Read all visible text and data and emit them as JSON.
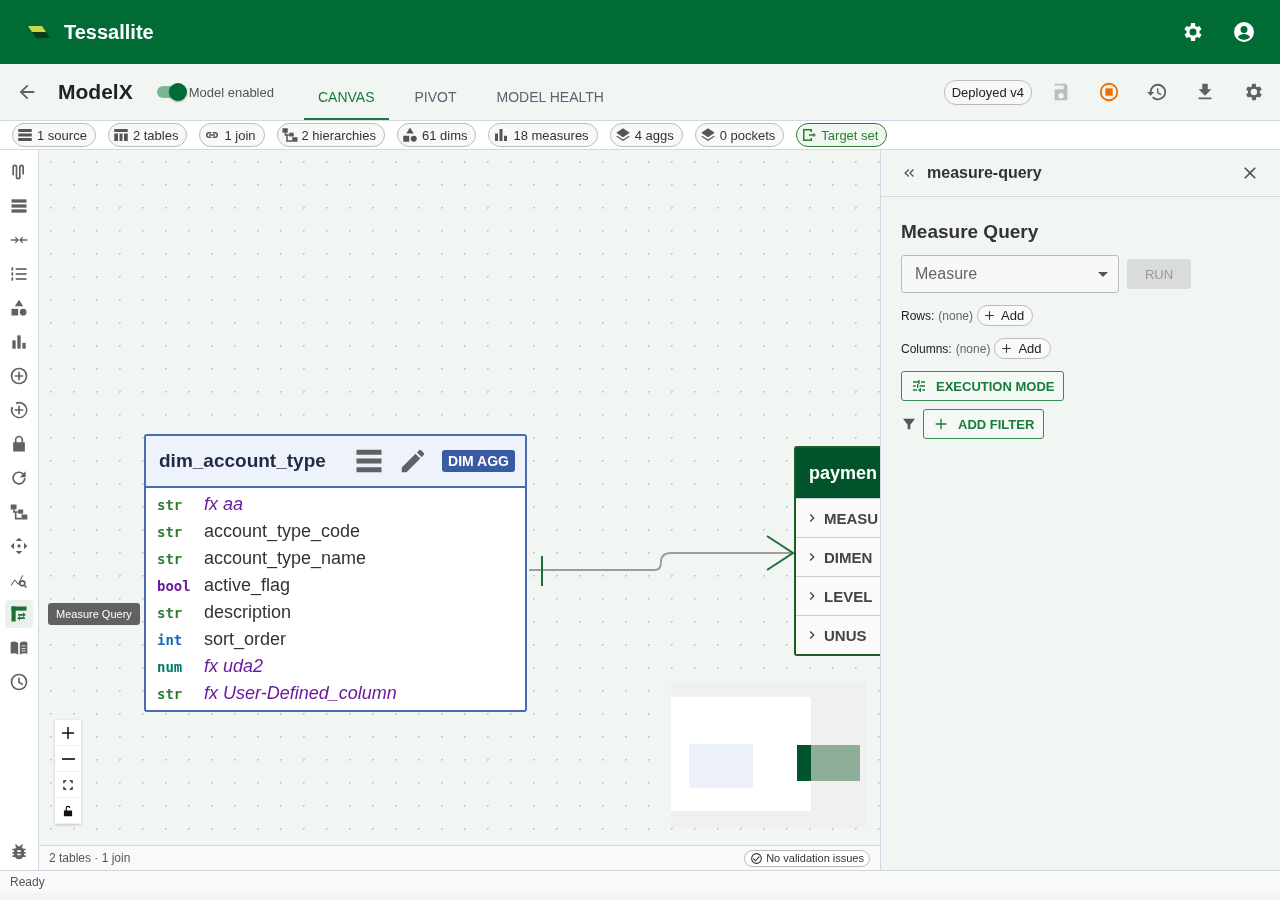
{
  "app": {
    "name": "Tessallite"
  },
  "toolbar": {
    "model_name": "ModelX",
    "toggle": {
      "label": "Model enabled",
      "on": true
    },
    "tabs": [
      {
        "label": "CANVAS",
        "selected": true
      },
      {
        "label": "PIVOT",
        "selected": false
      },
      {
        "label": "MODEL HEALTH",
        "selected": false
      }
    ],
    "version": "Deployed v4"
  },
  "chips": [
    {
      "kind": "source",
      "label": "1 source",
      "highlighted": false
    },
    {
      "kind": "tables",
      "label": "2 tables",
      "highlighted": false
    },
    {
      "kind": "join",
      "label": "1 join",
      "highlighted": false
    },
    {
      "kind": "hierarchy",
      "label": "2 hierarchies",
      "highlighted": false
    },
    {
      "kind": "dims",
      "label": "61 dims",
      "highlighted": false
    },
    {
      "kind": "measures",
      "label": "18 measures",
      "highlighted": false
    },
    {
      "kind": "layers",
      "label": "4 aggs",
      "highlighted": false
    },
    {
      "kind": "layers",
      "label": "0 pockets",
      "highlighted": false
    },
    {
      "kind": "target",
      "label": "Target set",
      "highlighted": true
    }
  ],
  "rail": {
    "items": [
      {
        "selected": false
      },
      {
        "selected": false
      },
      {
        "selected": false
      },
      {
        "selected": false
      },
      {
        "selected": false
      },
      {
        "selected": false
      },
      {
        "selected": false
      },
      {
        "selected": false
      },
      {
        "selected": false
      },
      {
        "selected": false
      },
      {
        "selected": false
      },
      {
        "selected": false
      },
      {
        "selected": false
      },
      {
        "selected": true
      },
      {
        "selected": false
      },
      {
        "selected": false
      }
    ],
    "tooltip": "Measure Query"
  },
  "canvas": {
    "tables": [
      {
        "name": "dim_account_type",
        "badge": "DIM AGG",
        "fields": [
          {
            "type": "str",
            "name": "fx aa",
            "computed": true
          },
          {
            "type": "str",
            "name": "account_type_code",
            "computed": false
          },
          {
            "type": "str",
            "name": "account_type_name",
            "computed": false
          },
          {
            "type": "bool",
            "name": "active_flag",
            "computed": false
          },
          {
            "type": "str",
            "name": "description",
            "computed": false
          },
          {
            "type": "int",
            "name": "sort_order",
            "computed": false
          },
          {
            "type": "num",
            "name": "fx uda2",
            "computed": true
          },
          {
            "type": "str",
            "name": "fx User-Defined_column",
            "computed": true
          }
        ]
      }
    ],
    "fact": {
      "name": "paymen",
      "sections": [
        "MEASU",
        "DIMEN",
        "LEVEL",
        "UNUS"
      ]
    },
    "footer": "2 tables · 1 join",
    "validation": "No validation issues"
  },
  "panel": {
    "id": "measure-query",
    "title": "Measure Query",
    "select_placeholder": "Measure",
    "run": "RUN",
    "rows_label": "Rows:",
    "rows_value": "(none)",
    "rows_add": "Add",
    "columns_label": "Columns:",
    "columns_value": "(none)",
    "columns_add": "Add",
    "execution_mode": "EXECUTION MODE",
    "add_filter": "ADD FILTER"
  },
  "status_bar": "Ready"
}
